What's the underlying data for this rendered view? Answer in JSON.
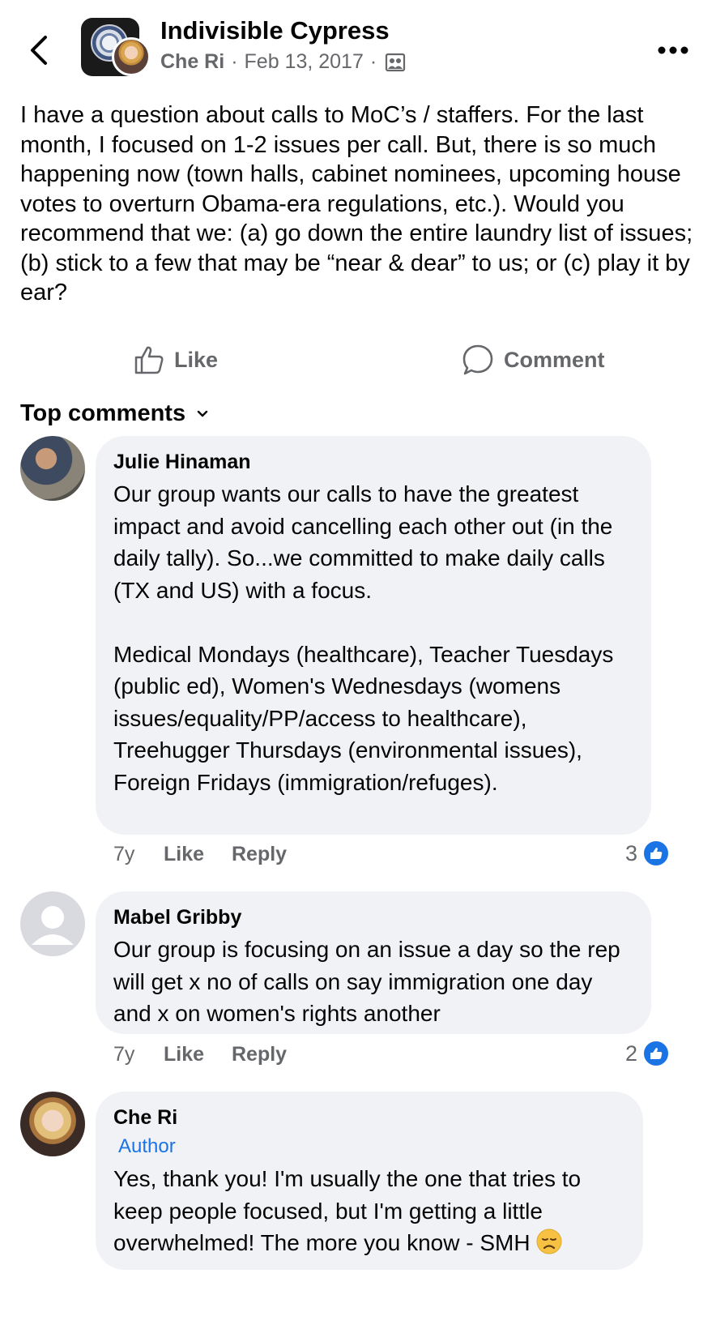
{
  "header": {
    "group_name": "Indivisible Cypress",
    "author": "Che Ri",
    "separator": "·",
    "date": "Feb 13, 2017",
    "icons": {
      "back": "chevron-left-icon",
      "privacy": "group-privacy-icon",
      "more": "more-options-icon"
    }
  },
  "post": {
    "text": "I have a question about calls to MoC’s / staffers. For the last month, I focused on 1-2 issues per call. But, there is so much happening now (town halls, cabinet nominees, upcoming house votes to overturn Obama-era  regulations, etc.). Would you recommend that we: (a) go down the entire laundry list of issues; (b) stick to a few that may be “near & dear” to us; or (c) play it by ear?"
  },
  "actions": {
    "like_label": "Like",
    "comment_label": "Comment"
  },
  "comments_header": {
    "label": "Top comments"
  },
  "comments": [
    {
      "name": "Julie Hinaman",
      "text": "Our group wants our calls to have the greatest impact and avoid cancelling each other out (in the daily tally). So...we committed to make daily calls (TX and US) with a focus.\n\nMedical Mondays (healthcare), Teacher Tuesdays (public ed), Women's Wednesdays (womens issues/equality/PP/access to healthcare), Treehugger Thursdays (environmental issues), Foreign Fridays (immigration/refuges).",
      "time": "7y",
      "like_label": "Like",
      "reply_label": "Reply",
      "reaction_count": "3"
    },
    {
      "name": "Mabel Gribby",
      "text": "Our group is focusing on an issue a day so the rep will get x no of calls on say immigration one day and x on women's rights another",
      "time": "7y",
      "like_label": "Like",
      "reply_label": "Reply",
      "reaction_count": "2"
    },
    {
      "name": "Che Ri",
      "badge": "Author",
      "text": "Yes, thank you! I'm usually the one that tries to keep people focused, but I'm getting a little overwhelmed! The more you know - SMH"
    }
  ],
  "colors": {
    "accent": "#1b74e4",
    "secondary_text": "#65676b",
    "bubble_bg": "#f0f2f5"
  }
}
